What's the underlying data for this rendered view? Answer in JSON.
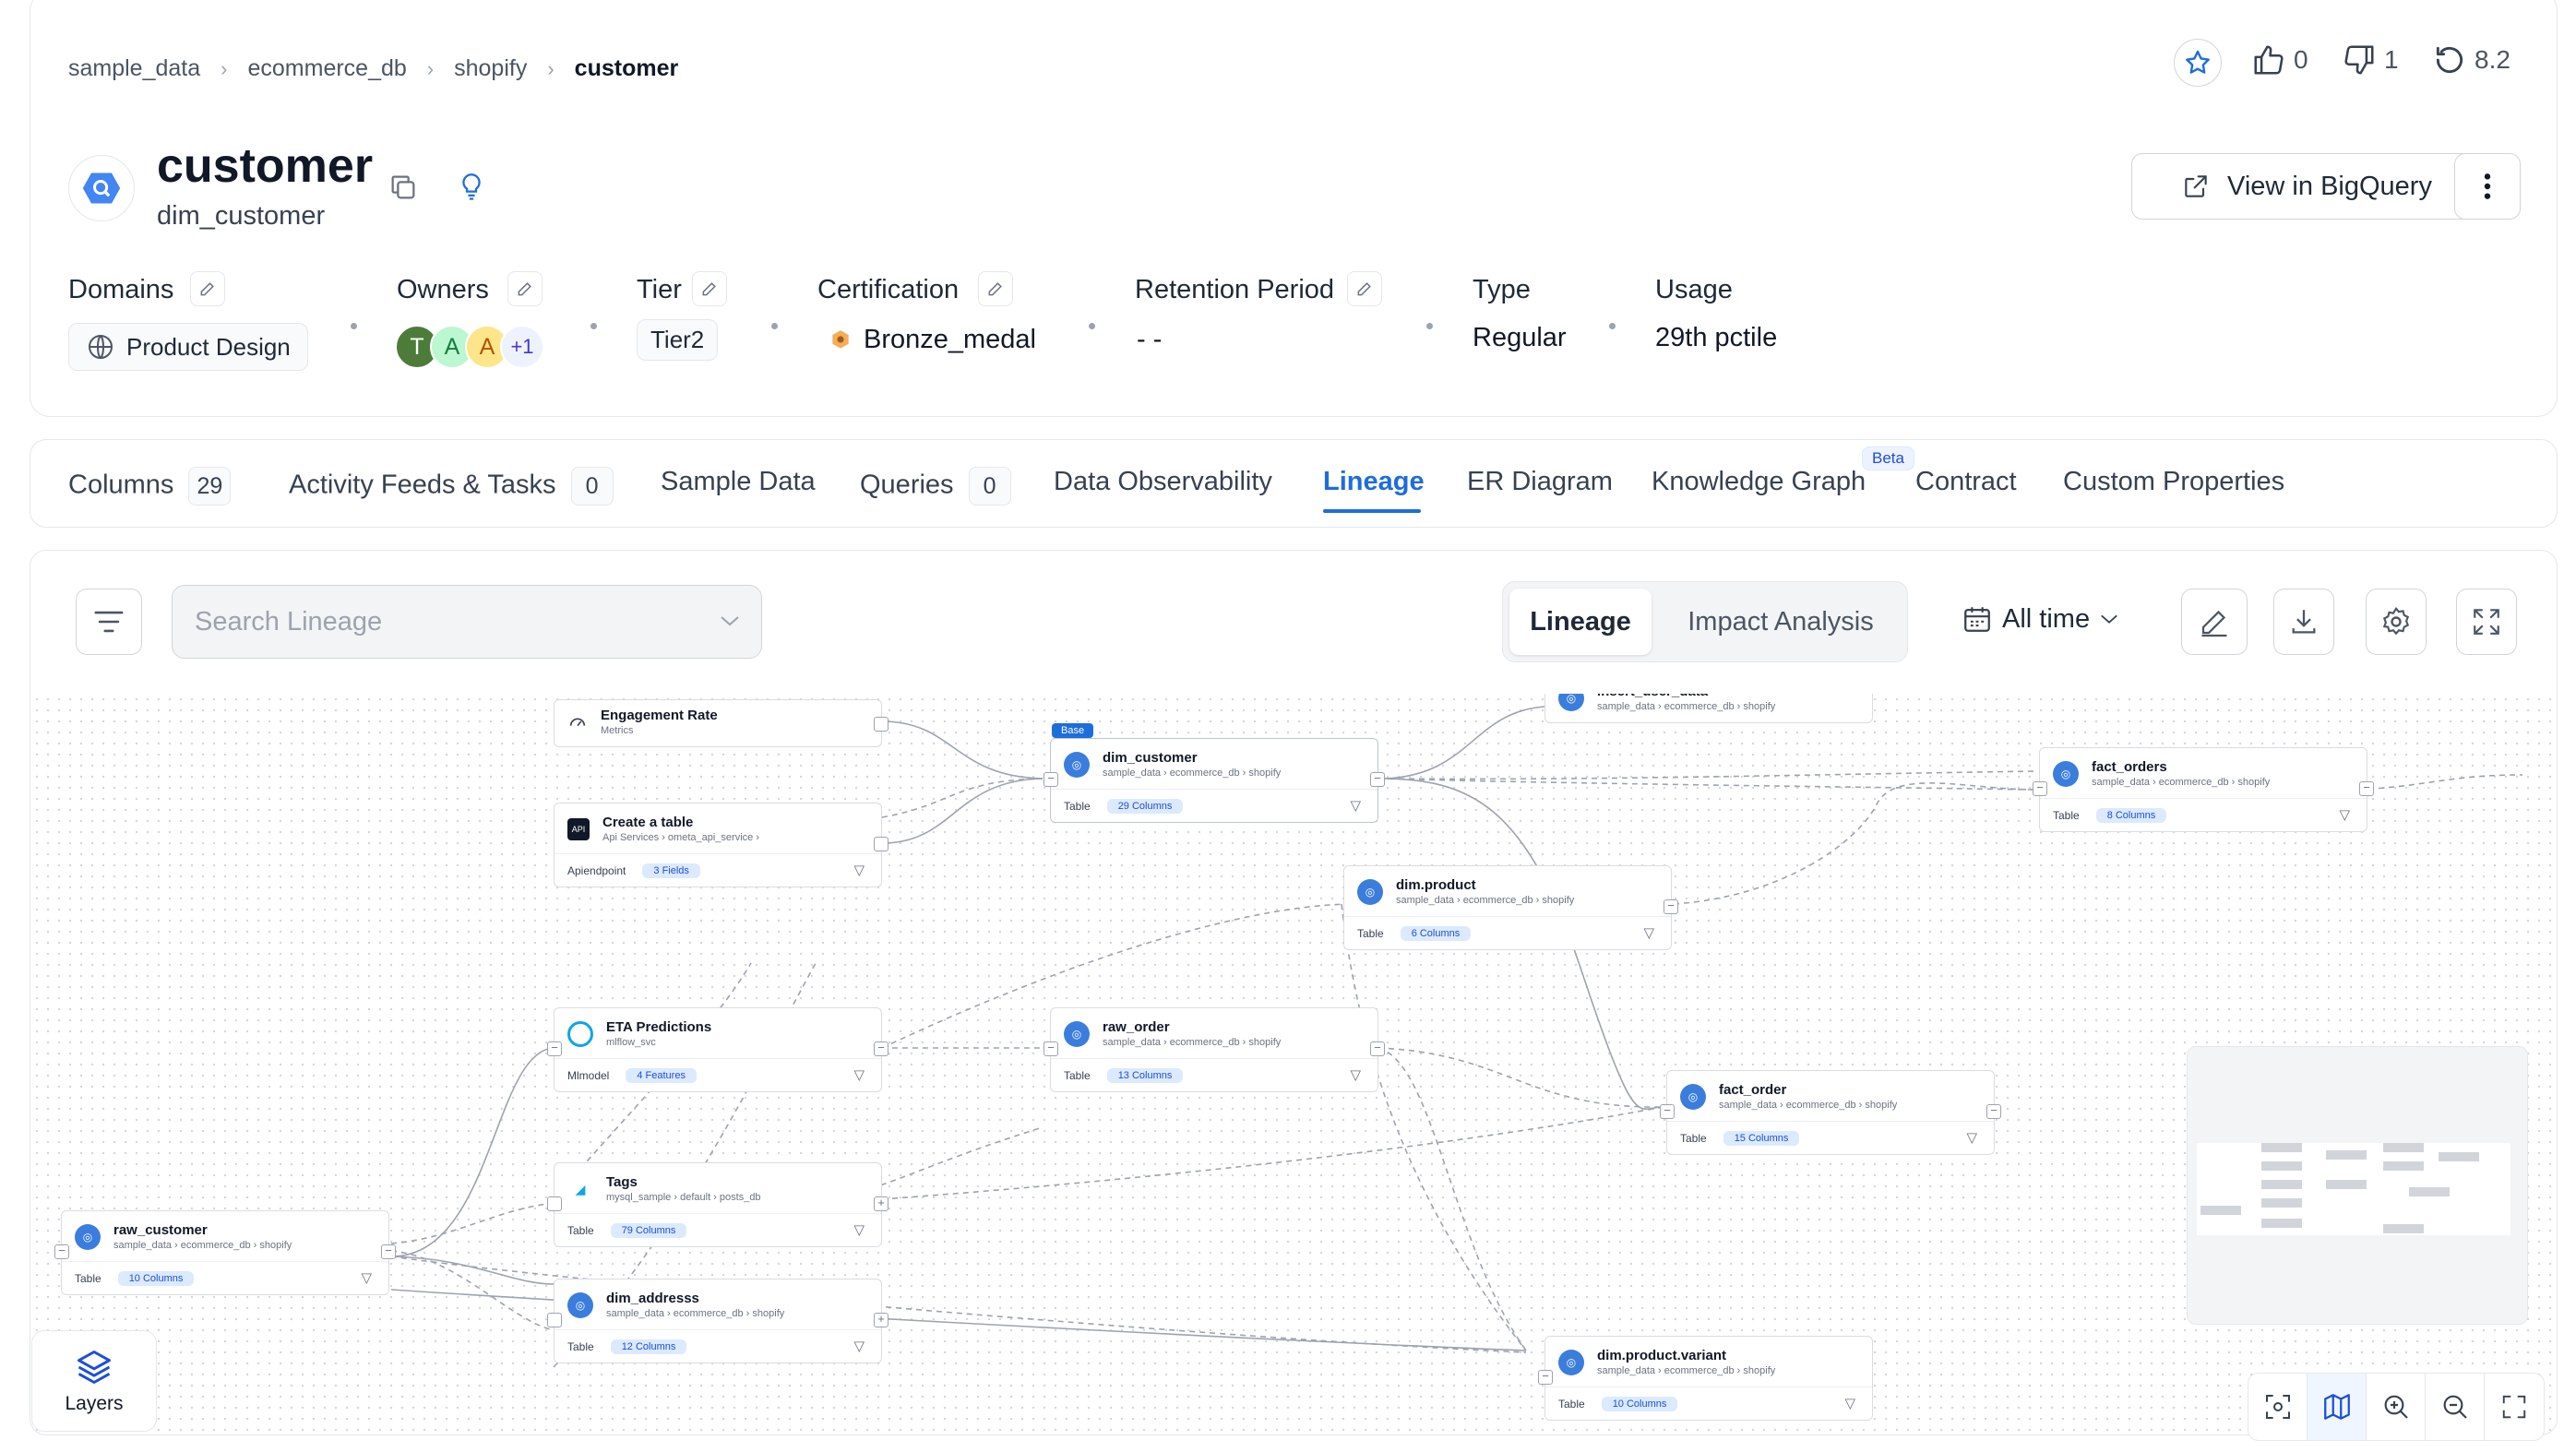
{
  "breadcrumb": [
    "sample_data",
    "ecommerce_db",
    "shopify",
    "customer"
  ],
  "header": {
    "title": "customer",
    "display_name": "dim_customer",
    "view_button": "View in BigQuery",
    "votes_up": "0",
    "votes_down": "1",
    "version": "8.2"
  },
  "properties": {
    "domains_label": "Domains",
    "domain_value": "Product Design",
    "owners_label": "Owners",
    "owners": [
      "T",
      "A",
      "A"
    ],
    "owners_more": "+1",
    "tier_label": "Tier",
    "tier_value": "Tier2",
    "certification_label": "Certification",
    "certification_value": "Bronze_medal",
    "retention_label": "Retention Period",
    "retention_value": "- -",
    "type_label": "Type",
    "type_value": "Regular",
    "usage_label": "Usage",
    "usage_value": "29th pctile"
  },
  "tabs": [
    {
      "label": "Columns",
      "count": "29"
    },
    {
      "label": "Activity Feeds & Tasks",
      "count": "0"
    },
    {
      "label": "Sample Data"
    },
    {
      "label": "Queries",
      "count": "0"
    },
    {
      "label": "Data Observability"
    },
    {
      "label": "Lineage",
      "active": true
    },
    {
      "label": "ER Diagram"
    },
    {
      "label": "Knowledge Graph",
      "badge": "Beta"
    },
    {
      "label": "Contract"
    },
    {
      "label": "Custom Properties"
    }
  ],
  "toolbar": {
    "search_placeholder": "Search Lineage",
    "mode_lineage": "Lineage",
    "mode_impact": "Impact Analysis",
    "time_filter": "All time"
  },
  "nodes": {
    "engagement": {
      "name": "Engagement Rate",
      "sub": "Metrics"
    },
    "create_table": {
      "name": "Create a table",
      "path1": "Api Services",
      "path2": "ometa_api_service",
      "type": "Apiendpoint",
      "count": "3 Fields"
    },
    "dim_customer": {
      "badge": "Base",
      "name": "dim_customer",
      "path1": "sample_data",
      "path2": "ecommerce_db",
      "path3": "shopify",
      "type": "Table",
      "count": "29 Columns"
    },
    "insert_user": {
      "name": "insert_user_data",
      "path1": "sample_data",
      "path2": "ecommerce_db",
      "path3": "shopify"
    },
    "fact_orders": {
      "name": "fact_orders",
      "path1": "sample_data",
      "path2": "ecommerce_db",
      "path3": "shopify",
      "type": "Table",
      "count": "8 Columns"
    },
    "dim_product": {
      "name": "dim.product",
      "path1": "sample_data",
      "path2": "ecommerce_db",
      "path3": "shopify",
      "type": "Table",
      "count": "6 Columns"
    },
    "eta": {
      "name": "ETA Predictions",
      "sub": "mlflow_svc",
      "type": "Mlmodel",
      "count": "4 Features"
    },
    "raw_order": {
      "name": "raw_order",
      "path1": "sample_data",
      "path2": "ecommerce_db",
      "path3": "shopify",
      "type": "Table",
      "count": "13 Columns"
    },
    "fact_order": {
      "name": "fact_order",
      "path1": "sample_data",
      "path2": "ecommerce_db",
      "path3": "shopify",
      "type": "Table",
      "count": "15 Columns"
    },
    "tags": {
      "name": "Tags",
      "path1": "mysql_sample",
      "path2": "default",
      "path3": "posts_db",
      "type": "Table",
      "count": "79 Columns"
    },
    "raw_customer": {
      "name": "raw_customer",
      "path1": "sample_data",
      "path2": "ecommerce_db",
      "path3": "shopify",
      "type": "Table",
      "count": "10 Columns"
    },
    "dim_address": {
      "name": "dim_addresss",
      "path1": "sample_data",
      "path2": "ecommerce_db",
      "path3": "shopify",
      "type": "Table",
      "count": "12 Columns"
    },
    "variant": {
      "name": "dim.product.variant",
      "path1": "sample_data",
      "path2": "ecommerce_db",
      "path3": "shopify",
      "type": "Table",
      "count": "10 Columns"
    }
  },
  "layers_label": "Layers",
  "colors": {
    "accent": "#1d6ddb",
    "node_icon": "#3b7ddd",
    "pill_bg": "#dbeafe"
  }
}
